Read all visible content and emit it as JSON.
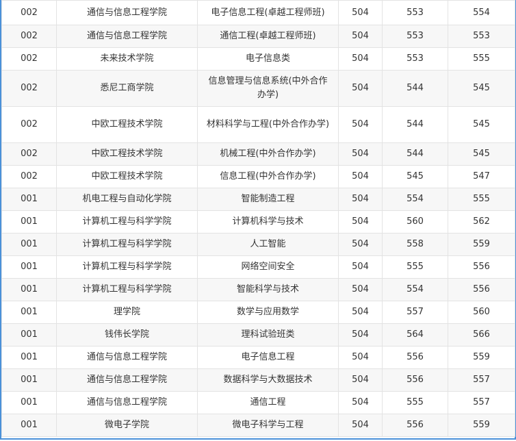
{
  "rows": [
    {
      "code": "002",
      "college": "通信与信息工程学院",
      "major": "电子信息工程(卓越工程师班)",
      "min": "504",
      "low": "553",
      "high": "554"
    },
    {
      "code": "002",
      "college": "通信与信息工程学院",
      "major": "通信工程(卓越工程师班)",
      "min": "504",
      "low": "553",
      "high": "553"
    },
    {
      "code": "002",
      "college": "未来技术学院",
      "major": "电子信息类",
      "min": "504",
      "low": "553",
      "high": "555"
    },
    {
      "code": "002",
      "college": "悉尼工商学院",
      "major": "信息管理与信息系统(中外合作办学)",
      "min": "504",
      "low": "544",
      "high": "545"
    },
    {
      "code": "002",
      "college": "中欧工程技术学院",
      "major": "材料科学与工程(中外合作办学)",
      "min": "504",
      "low": "544",
      "high": "545"
    },
    {
      "code": "002",
      "college": "中欧工程技术学院",
      "major": "机械工程(中外合作办学)",
      "min": "504",
      "low": "544",
      "high": "545"
    },
    {
      "code": "002",
      "college": "中欧工程技术学院",
      "major": "信息工程(中外合作办学)",
      "min": "504",
      "low": "545",
      "high": "547"
    },
    {
      "code": "001",
      "college": "机电工程与自动化学院",
      "major": "智能制造工程",
      "min": "504",
      "low": "554",
      "high": "555"
    },
    {
      "code": "001",
      "college": "计算机工程与科学学院",
      "major": "计算机科学与技术",
      "min": "504",
      "low": "560",
      "high": "562"
    },
    {
      "code": "001",
      "college": "计算机工程与科学学院",
      "major": "人工智能",
      "min": "504",
      "low": "558",
      "high": "559"
    },
    {
      "code": "001",
      "college": "计算机工程与科学学院",
      "major": "网络空间安全",
      "min": "504",
      "low": "555",
      "high": "556"
    },
    {
      "code": "001",
      "college": "计算机工程与科学学院",
      "major": "智能科学与技术",
      "min": "504",
      "low": "554",
      "high": "556"
    },
    {
      "code": "001",
      "college": "理学院",
      "major": "数学与应用数学",
      "min": "504",
      "low": "557",
      "high": "560"
    },
    {
      "code": "001",
      "college": "钱伟长学院",
      "major": "理科试验班类",
      "min": "504",
      "low": "564",
      "high": "566"
    },
    {
      "code": "001",
      "college": "通信与信息工程学院",
      "major": "电子信息工程",
      "min": "504",
      "low": "556",
      "high": "559"
    },
    {
      "code": "001",
      "college": "通信与信息工程学院",
      "major": "数据科学与大数据技术",
      "min": "504",
      "low": "556",
      "high": "557"
    },
    {
      "code": "001",
      "college": "通信与信息工程学院",
      "major": "通信工程",
      "min": "504",
      "low": "555",
      "high": "557"
    },
    {
      "code": "001",
      "college": "微电子学院",
      "major": "微电子科学与工程",
      "min": "504",
      "low": "556",
      "high": "559"
    }
  ]
}
